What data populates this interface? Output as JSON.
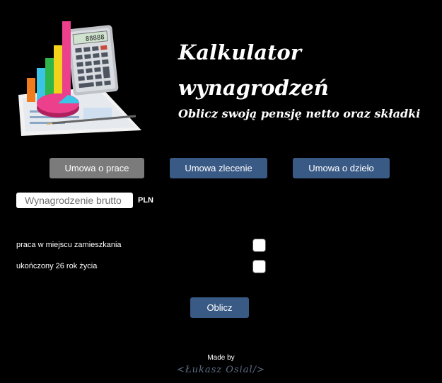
{
  "header": {
    "title_line1": "Kalkulator",
    "title_line2": "wynagrodzeń",
    "subtitle": "Oblicz swoją pensję netto oraz składki"
  },
  "logo": {
    "icon": "calculator-chart-illustration-icon"
  },
  "tabs": [
    {
      "label": "Umowa o prace",
      "active": true
    },
    {
      "label": "Umowa zlecenie",
      "active": false
    },
    {
      "label": "Umowa o dzieło",
      "active": false
    }
  ],
  "salary": {
    "placeholder": "Wynagrodzenie brutto",
    "value": "",
    "currency": "PLN"
  },
  "options": [
    {
      "label": "praca w miejscu zamieszkania",
      "checked": false
    },
    {
      "label": "ukończony 26 rok życia",
      "checked": false
    }
  ],
  "calculate_label": "Oblicz",
  "footer": {
    "made_by": "Made by",
    "signature": "<Łukasz Osial/>"
  },
  "colors": {
    "background": "#000000",
    "button": "#3a5a86",
    "active_tab": "#7b7b7b"
  }
}
